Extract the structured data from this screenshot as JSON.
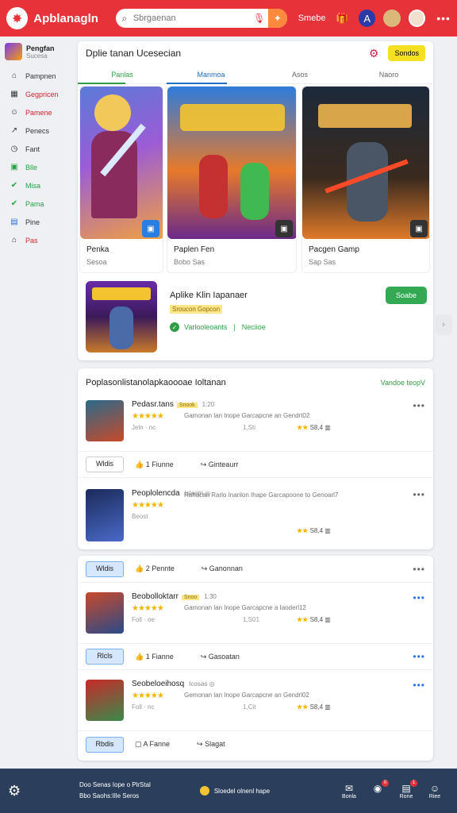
{
  "app": {
    "brand": "Apblanagln"
  },
  "search": {
    "placeholder": "Sbrgaenan",
    "value": ""
  },
  "topbar": {
    "link": "Smebe"
  },
  "sidebar": {
    "profile": {
      "name": "Pengfan",
      "sub": "Sucesa"
    },
    "items": [
      {
        "label": "Pampnen",
        "icon": "home-icon",
        "style": ""
      },
      {
        "label": "Gegpricen",
        "icon": "grid-icon",
        "style": "red"
      },
      {
        "label": "Pamene",
        "icon": "user-icon",
        "style": "red"
      },
      {
        "label": "Penecs",
        "icon": "chart-icon",
        "style": ""
      },
      {
        "label": "Fant",
        "icon": "clock-icon",
        "style": ""
      },
      {
        "label": "Blle",
        "icon": "bag-icon",
        "style": "green"
      },
      {
        "label": "Misa",
        "icon": "check-icon",
        "style": "green"
      },
      {
        "label": "Pama",
        "icon": "check-icon",
        "style": "green"
      },
      {
        "label": "Pine",
        "icon": "store-icon",
        "style": "blue"
      },
      {
        "label": "Pas",
        "icon": "home-icon",
        "style": "red"
      }
    ]
  },
  "featured": {
    "title": "Dplie tanan Ucesecian",
    "button": "Sondos",
    "tabs": [
      "Panlas",
      "Manmoa",
      "Asos",
      "Naoro"
    ],
    "cards": [
      {
        "name": "Penka",
        "sub": "Sesoa"
      },
      {
        "name": "Paplen Fen",
        "sub": "Bobo Sas"
      },
      {
        "name": "Pacgen Gamp",
        "sub": "Sap Sas"
      }
    ],
    "banner": {
      "title": "Aplike Klin Iapanaer",
      "subtitle": "Sroucon Gopcon",
      "status": "Varlooleoants",
      "link": "Neciioe",
      "button": "Soabe"
    }
  },
  "posts_section": {
    "title": "Poplasonlistanolapkaoooae Ioltanan",
    "link": "Vandoe teopV"
  },
  "posts": [
    {
      "name": "Pedasr.tans",
      "tag": "Snook",
      "meta": "1:20",
      "text": "Gamonan lan Inope Garcapcne an Gendrt02",
      "left": "Jeln · nc",
      "mid": "1,Sti",
      "score": "S8,4",
      "more_blue": false,
      "has_actions_after": true
    },
    {
      "name": "Peoplolencda",
      "tag": "",
      "meta": "Islaetn ◎",
      "text": "Rahacan Rarlo Inanlon Ihape Garcapoone to Genoarl7",
      "left": "Beost",
      "mid": "",
      "score": "S8,4",
      "more_blue": false,
      "has_actions_after": false
    },
    {
      "name": "Beobolloktarr",
      "tag": "Snoo",
      "meta": "1:30",
      "text": "Gamonan lan Inope Garcapcne a Iaoderl12",
      "left": "Foll · oe",
      "mid": "1,S01",
      "score": "S8,4",
      "more_blue": true,
      "has_actions_after": true
    },
    {
      "name": "Seobeloeihosq",
      "tag": "",
      "meta": "Icosas ◎",
      "text": "Gemonan lan Inope Garcapcne an Gendrl02",
      "left": "Foll · nc",
      "mid": "1,Cit",
      "score": "S8,4",
      "more_blue": true,
      "has_actions_after": true
    }
  ],
  "actions": [
    {
      "a1": "Wldis",
      "a2": "1 Fiunne",
      "a3": "Ginteaurr"
    },
    {
      "a1": "Wldis",
      "a2": "2 Pennte",
      "a3": "Ganonnan"
    },
    {
      "a1": "Rlcls",
      "a2": "1 Fianne",
      "a3": "Gasoatan"
    },
    {
      "a1": "Rbdis",
      "a2": "A Fanne",
      "a3": "Slagat"
    }
  ],
  "bottombar": {
    "text1": "Doo Senas Iope o PlrStal",
    "text2": "Bbo Saohs:IIle Seros",
    "badge": "Sloedel olnenl hape",
    "nav": [
      {
        "label": "Bonla",
        "badge": ""
      },
      {
        "label": "",
        "badge": "0"
      },
      {
        "label": "Rone",
        "badge": "1"
      },
      {
        "label": "Riee",
        "badge": ""
      }
    ]
  }
}
